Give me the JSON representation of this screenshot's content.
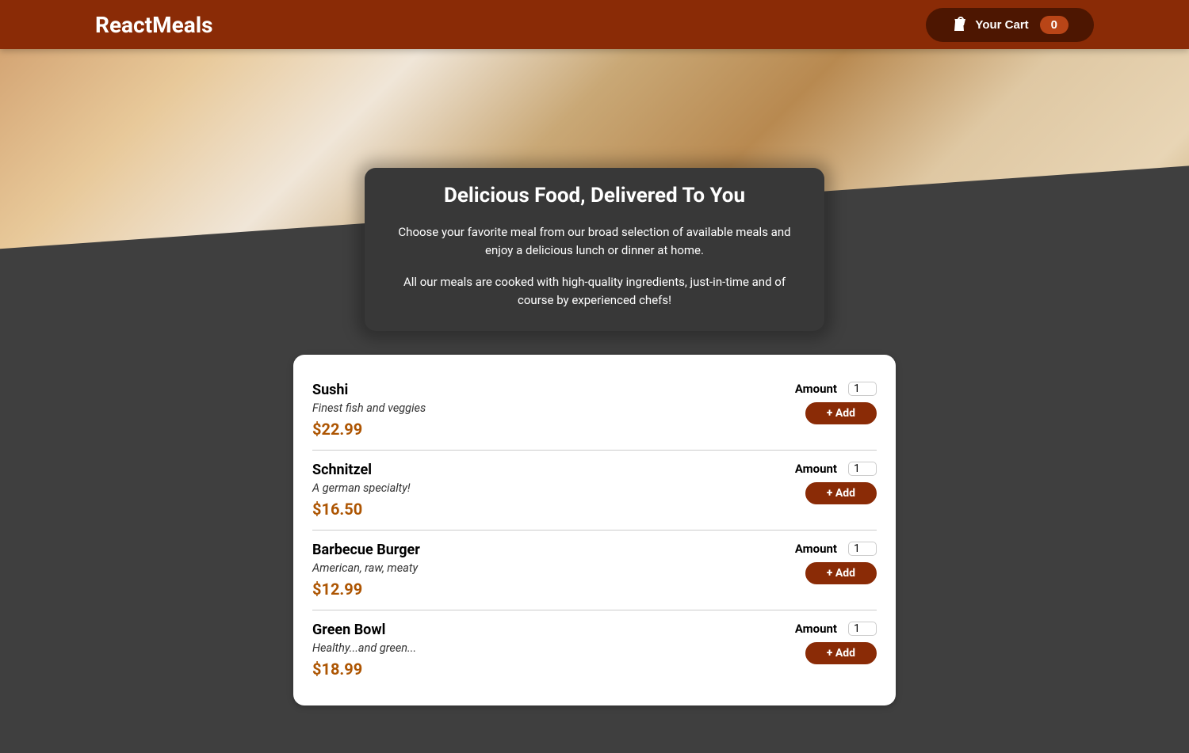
{
  "header": {
    "title": "ReactMeals",
    "cart_label": "Your Cart",
    "cart_count": "0"
  },
  "summary": {
    "heading": "Delicious Food, Delivered To You",
    "p1": "Choose your favorite meal from our broad selection of available meals and enjoy a delicious lunch or dinner at home.",
    "p2": "All our meals are cooked with high-quality ingredients, just-in-time and of course by experienced chefs!"
  },
  "labels": {
    "amount": "Amount",
    "add_button": "+ Add"
  },
  "meals": [
    {
      "name": "Sushi",
      "description": "Finest fish and veggies",
      "price": "$22.99",
      "amount": "1"
    },
    {
      "name": "Schnitzel",
      "description": "A german specialty!",
      "price": "$16.50",
      "amount": "1"
    },
    {
      "name": "Barbecue Burger",
      "description": "American, raw, meaty",
      "price": "$12.99",
      "amount": "1"
    },
    {
      "name": "Green Bowl",
      "description": "Healthy...and green...",
      "price": "$18.99",
      "amount": "1"
    }
  ]
}
